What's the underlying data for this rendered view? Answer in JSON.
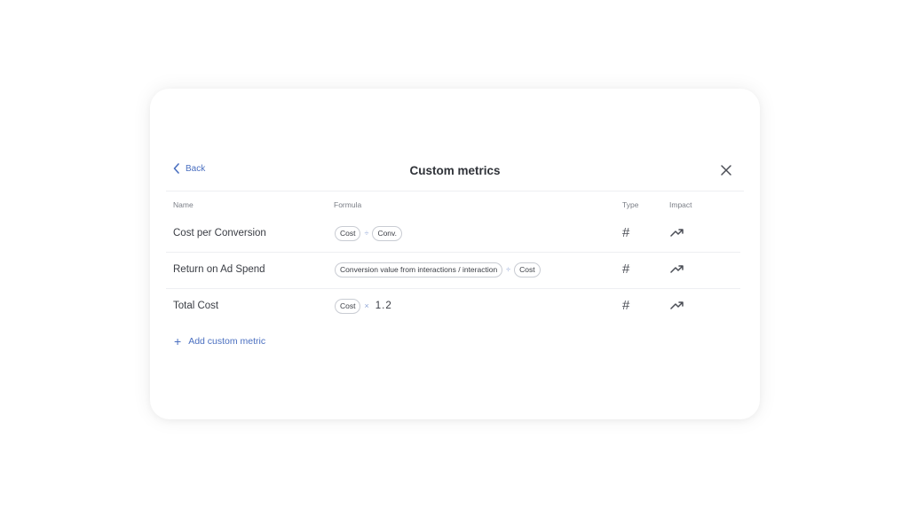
{
  "dialog": {
    "title": "Custom metrics",
    "back_label": "Back"
  },
  "columns": {
    "name": "Name",
    "formula": "Formula",
    "type": "Type",
    "impact": "Impact"
  },
  "metrics": [
    {
      "name": "Cost per Conversion",
      "formula": [
        {
          "kind": "chip",
          "text": "Cost"
        },
        {
          "kind": "op",
          "text": "÷"
        },
        {
          "kind": "chip",
          "text": "Conv."
        }
      ],
      "type_icon": "#",
      "impact_icon": "trending-up-icon"
    },
    {
      "name": "Return on Ad Spend",
      "formula": [
        {
          "kind": "chip",
          "text": "Conversion value from interactions / interaction"
        },
        {
          "kind": "op",
          "text": "÷"
        },
        {
          "kind": "chip",
          "text": "Cost"
        }
      ],
      "type_icon": "#",
      "impact_icon": "trending-up-icon"
    },
    {
      "name": "Total Cost",
      "formula": [
        {
          "kind": "chip",
          "text": "Cost"
        },
        {
          "kind": "op",
          "text": "×"
        },
        {
          "kind": "num",
          "text": "1.2"
        }
      ],
      "type_icon": "#",
      "impact_icon": "trending-up-icon"
    }
  ],
  "add_metric": {
    "icon": "+",
    "label": "Add custom metric"
  },
  "colors": {
    "accent": "#4a6fc0",
    "operator": "#8fa5d6",
    "text": "#3a3d44"
  }
}
